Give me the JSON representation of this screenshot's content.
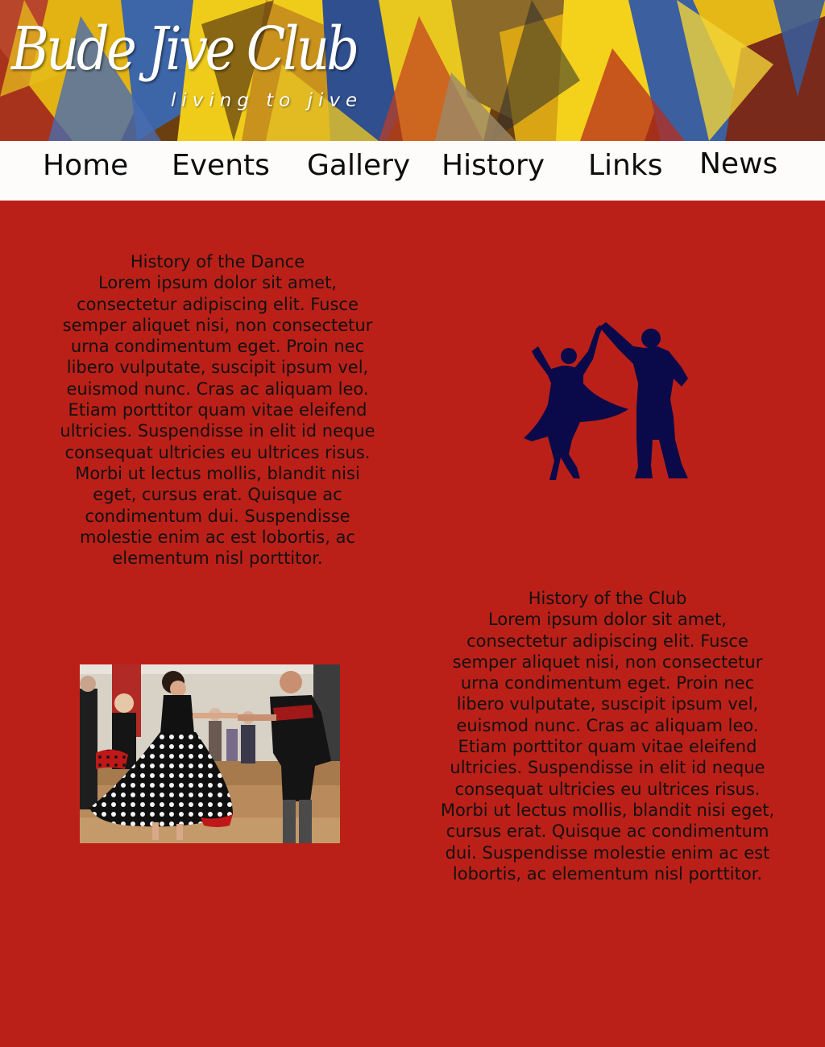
{
  "site": {
    "logo_main": "Bude Jive Club",
    "logo_tagline": "living to jive"
  },
  "nav": {
    "items": [
      {
        "label": "Home"
      },
      {
        "label": "Events"
      },
      {
        "label": "Gallery"
      },
      {
        "label": "History"
      },
      {
        "label": "Links"
      },
      {
        "label": "News"
      }
    ]
  },
  "sections": {
    "dance": {
      "heading": "History of the Dance",
      "body": "Lorem ipsum dolor sit amet, consectetur adipiscing elit. Fusce semper aliquet nisi, non consectetur urna condimentum eget. Proin nec libero vulputate, suscipit ipsum vel, euismod nunc. Cras ac aliquam leo. Etiam porttitor quam vitae eleifend ultricies. Suspendisse in elit id neque consequat ultricies eu ultrices risus. Morbi ut lectus mollis, blandit nisi eget, cursus erat. Quisque ac condimentum dui. Suspendisse molestie enim ac est lobortis, ac elementum nisl porttitor."
    },
    "club": {
      "heading": "History of the Club",
      "body": "Lorem ipsum dolor sit amet, consectetur adipiscing elit. Fusce semper aliquet nisi, non consectetur urna condimentum eget. Proin nec libero vulputate, suscipit ipsum vel, euismod nunc. Cras ac aliquam leo. Etiam porttitor quam vitae eleifend ultricies. Suspendisse in elit id neque consequat ultricies eu ultrices risus. Morbi ut lectus mollis, blandit nisi eget, cursus erat. Quisque ac condimentum dui. Suspendisse molestie enim ac est lobortis, ac elementum nisl porttitor."
    }
  },
  "images": {
    "silhouette_icon": "jive-dancers-silhouette-icon",
    "photo_icon": "dancing-couple-photo"
  },
  "colors": {
    "page_background": "#bb2018",
    "nav_background": "#fdfcfb",
    "silhouette": "#0a0a4a",
    "text": "#111111"
  }
}
